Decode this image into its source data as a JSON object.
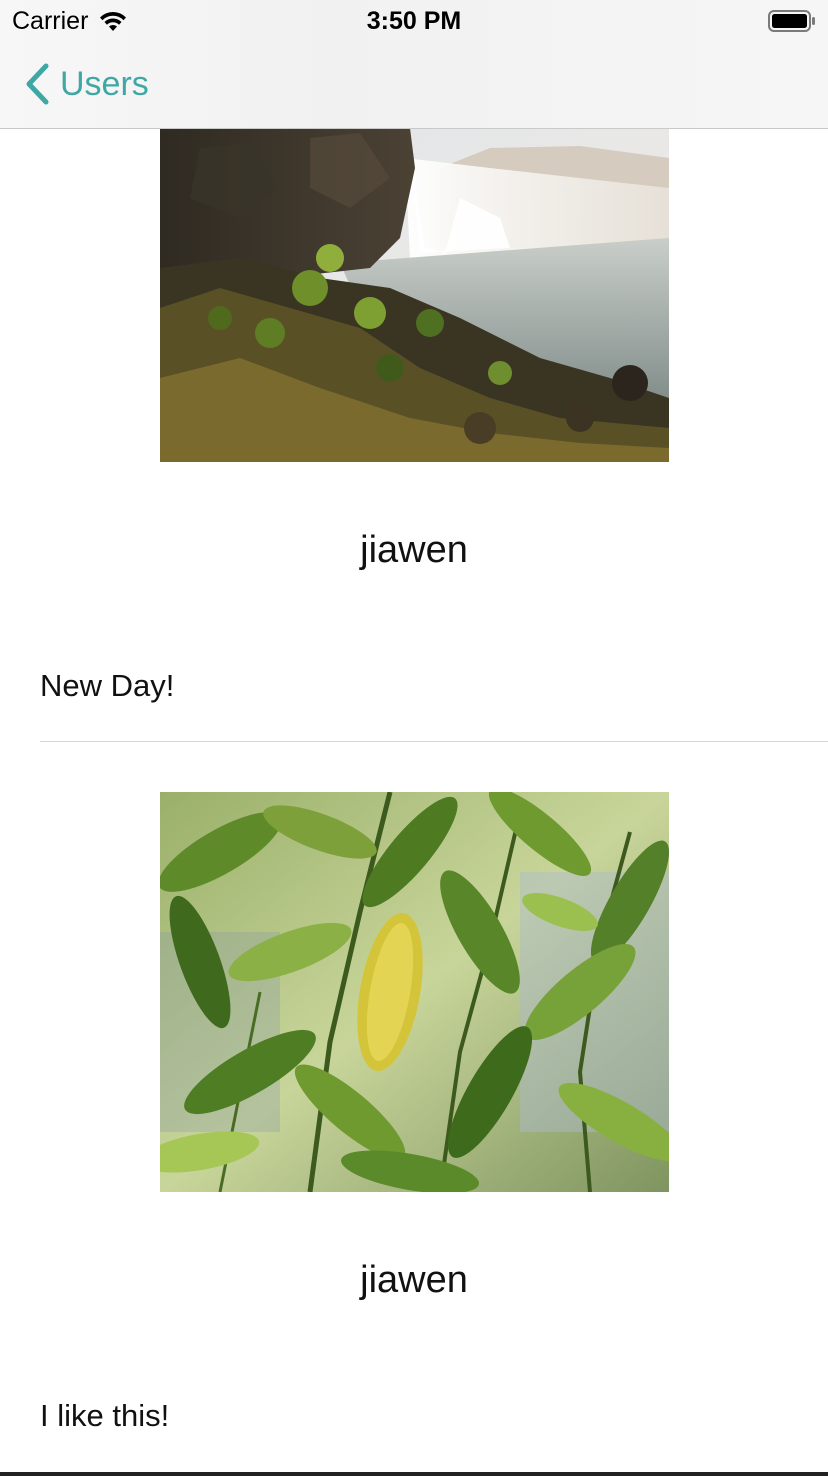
{
  "status_bar": {
    "carrier": "Carrier",
    "time": "3:50 PM"
  },
  "nav": {
    "back_label": "Users"
  },
  "posts": [
    {
      "username": "jiawen",
      "text": "New Day!",
      "image_icon": "waterfall-photo"
    },
    {
      "username": "jiawen",
      "text": "I like this!",
      "image_icon": "leaves-photo"
    }
  ],
  "colors": {
    "accent": "#3fa8a4"
  }
}
